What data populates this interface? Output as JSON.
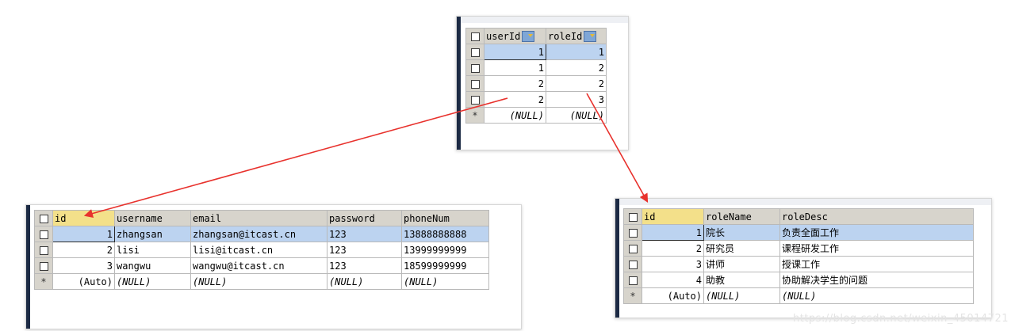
{
  "user_role": {
    "columns": [
      "userId",
      "roleId"
    ],
    "rows": [
      {
        "userId": "1",
        "roleId": "1"
      },
      {
        "userId": "1",
        "roleId": "2"
      },
      {
        "userId": "2",
        "roleId": "2"
      },
      {
        "userId": "2",
        "roleId": "3"
      }
    ],
    "new_row": {
      "userId": "(NULL)",
      "roleId": "(NULL)"
    }
  },
  "users": {
    "columns": [
      "id",
      "username",
      "email",
      "password",
      "phoneNum"
    ],
    "rows": [
      {
        "id": "1",
        "username": "zhangsan",
        "email": "zhangsan@itcast.cn",
        "password": "123",
        "phoneNum": "13888888888"
      },
      {
        "id": "2",
        "username": "lisi",
        "email": "lisi@itcast.cn",
        "password": "123",
        "phoneNum": "13999999999"
      },
      {
        "id": "3",
        "username": "wangwu",
        "email": "wangwu@itcast.cn",
        "password": "123",
        "phoneNum": "18599999999"
      }
    ],
    "new_row": {
      "id": "(Auto)",
      "username": "(NULL)",
      "email": "(NULL)",
      "password": "(NULL)",
      "phoneNum": "(NULL)"
    }
  },
  "roles": {
    "columns": [
      "id",
      "roleName",
      "roleDesc"
    ],
    "rows": [
      {
        "id": "1",
        "roleName": "院长",
        "roleDesc": "负责全面工作"
      },
      {
        "id": "2",
        "roleName": "研究员",
        "roleDesc": "课程研发工作"
      },
      {
        "id": "3",
        "roleName": "讲师",
        "roleDesc": "授课工作"
      },
      {
        "id": "4",
        "roleName": "助教",
        "roleDesc": "协助解决学生的问题"
      }
    ],
    "new_row": {
      "id": "(Auto)",
      "roleName": "(NULL)",
      "roleDesc": "(NULL)"
    }
  },
  "new_row_marker": "*",
  "watermark": "https://blog.csdn.net/weixin_45014721",
  "colors": {
    "arrow": "#e8322d",
    "header": "#d7d4cc",
    "pk_header": "#f3e08a",
    "selected": "#bcd3f0",
    "sidebar": "#1c2a44"
  }
}
